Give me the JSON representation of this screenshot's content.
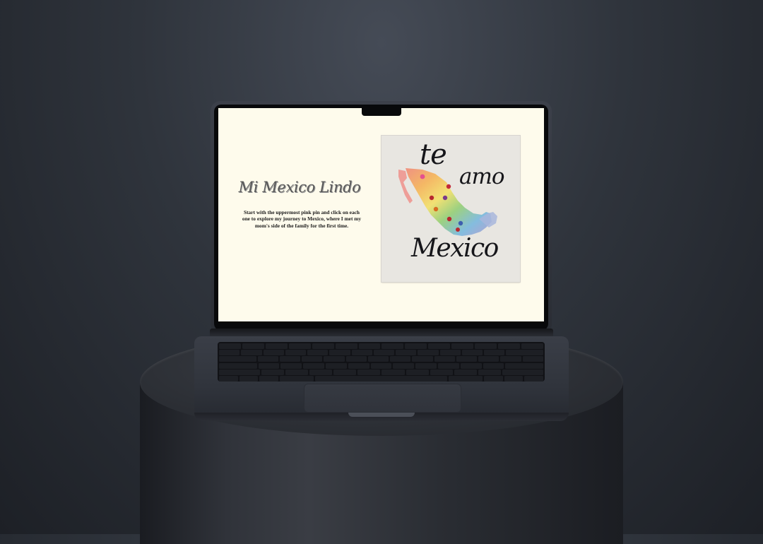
{
  "website": {
    "title": "Mi Mexico Lindo",
    "intro": "Start with the uppermost pink pin and click on each one to explore my journey to Mexico, where I met my mom's side of the family for the first time."
  },
  "artwork": {
    "lettering_top": "te",
    "lettering_middle": "amo",
    "lettering_bottom": "Mexico",
    "pins": [
      "pink",
      "red",
      "red",
      "purple",
      "orange",
      "red",
      "blue",
      "red"
    ]
  },
  "colors": {
    "screen_background": "#fefbec",
    "title_text": "#5a5a5a",
    "body_text": "#1a1a1a",
    "pin": "#c22a5e"
  }
}
